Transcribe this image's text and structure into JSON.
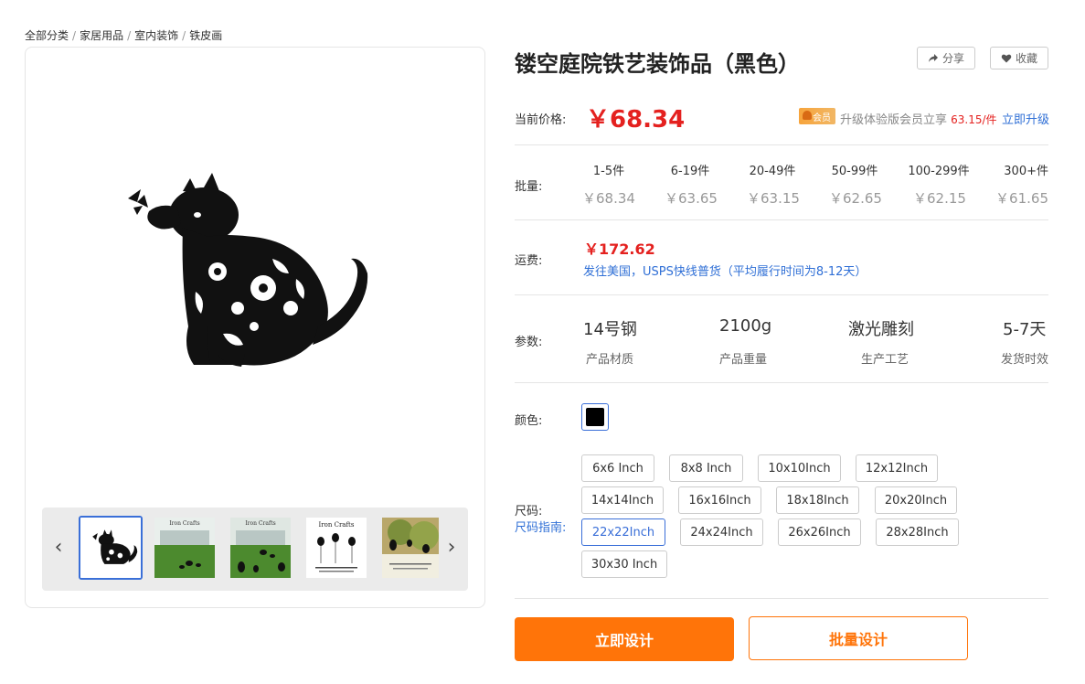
{
  "breadcrumb": {
    "items": [
      "全部分类",
      "家居用品",
      "室内装饰",
      "铁皮画"
    ],
    "separator": "/"
  },
  "product": {
    "title": "镂空庭院铁艺装饰品（黑色）"
  },
  "actions": {
    "share_label": "分享",
    "favorite_label": "收藏"
  },
  "price": {
    "label": "当前价格:",
    "value": "￥68.34",
    "vip_badge": "会员",
    "vip_text": "升级体验版会员立享",
    "vip_price": "63.15/件",
    "upgrade_link": "立即升级"
  },
  "bulk": {
    "label": "批量:",
    "tiers": [
      {
        "range": "1-5件",
        "price": "￥68.34"
      },
      {
        "range": "6-19件",
        "price": "￥63.65"
      },
      {
        "range": "20-49件",
        "price": "￥63.15"
      },
      {
        "range": "50-99件",
        "price": "￥62.65"
      },
      {
        "range": "100-299件",
        "price": "￥62.15"
      },
      {
        "range": "300+件",
        "price": "￥61.65"
      }
    ]
  },
  "shipping": {
    "label": "运费:",
    "price": "￥172.62",
    "description": "发往美国，USPS快线普货（平均履行时间为8-12天）"
  },
  "params": {
    "label": "参数:",
    "items": [
      {
        "value": "14号钢",
        "key": "产品材质"
      },
      {
        "value": "2100g",
        "key": "产品重量"
      },
      {
        "value": "激光雕刻",
        "key": "生产工艺"
      },
      {
        "value": "5-7天",
        "key": "发货时效"
      }
    ]
  },
  "color": {
    "label": "颜色:",
    "selected": "#000000"
  },
  "size": {
    "label": "尺码:",
    "guide_link": "尺码指南:",
    "selected": "22x22Inch",
    "options": [
      "6x6 Inch",
      "8x8 Inch",
      "10x10Inch",
      "12x12Inch",
      "14x14Inch",
      "16x16Inch",
      "18x18Inch",
      "20x20Inch",
      "22x22Inch",
      "24x24Inch",
      "26x26Inch",
      "28x28Inch",
      "30x30 Inch"
    ]
  },
  "buttons": {
    "design": "立即设计",
    "bulk_design": "批量设计"
  },
  "gallery": {
    "thumb_caption": "Iron Crafts",
    "active_thumb": 1
  },
  "colors": {
    "accent": "#ff7409",
    "price_red": "#e4211f",
    "link_blue": "#2f6fd6",
    "selected_border": "#3a6fd8"
  }
}
